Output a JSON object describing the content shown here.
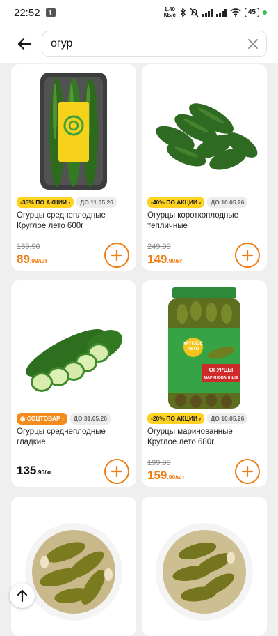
{
  "status_bar": {
    "time": "22:52",
    "app_icon_letter": "t",
    "net_speed_top": "1.40",
    "net_speed_bottom": "КБ/с",
    "battery": "45"
  },
  "search": {
    "query": "огур"
  },
  "products": [
    {
      "badge": "-35% ПО АКЦИИ",
      "badge_type": "promo",
      "date": "ДО 11.05.26",
      "name": "Огурцы среднеплодные Круглое лето 600г",
      "old_price": "139.90",
      "price_main": "89",
      "price_sub": ".99/шт",
      "price_color": "orange"
    },
    {
      "badge": "-40% ПО АКЦИИ",
      "badge_type": "promo",
      "date": "ДО 10.05.26",
      "name": "Огурцы короткоплодные тепличные",
      "old_price": "249.90",
      "price_main": "149",
      "price_sub": ".90/кг",
      "price_color": "orange"
    },
    {
      "badge": "СОЦТОВАР",
      "badge_type": "social",
      "date": "ДО 31.05.26",
      "name": "Огурцы среднеплодные гладкие",
      "old_price": "",
      "price_main": "135",
      "price_sub": ".90/кг",
      "price_color": "black"
    },
    {
      "badge": "-20% ПО АКЦИИ",
      "badge_type": "promo",
      "date": "ДО 10.05.26",
      "name": "Огурцы маринованные Круглое лето 680г",
      "old_price": "199.90",
      "price_main": "159",
      "price_sub": ".90/шт",
      "price_color": "orange"
    }
  ],
  "jar_label": {
    "brand_line1": "КРУГЛОЕ",
    "brand_line2": "ЛЕТО",
    "title_line1": "ОГУРЦЫ",
    "title_line2": "МАРИНОВАННЫЕ"
  },
  "colors": {
    "accent": "#f07d12",
    "promo_badge": "#ffd21f",
    "social_badge": "#f38a1c"
  }
}
